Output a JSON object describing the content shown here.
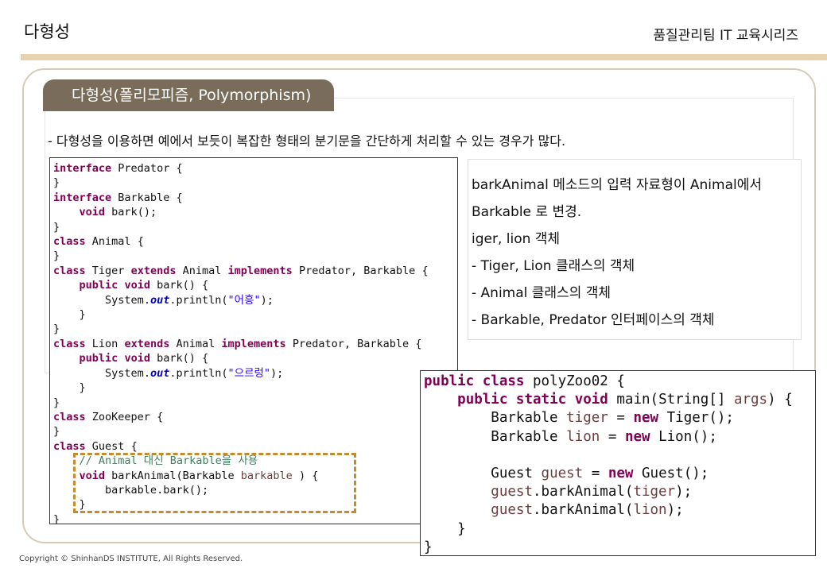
{
  "header": {
    "title": "다형성",
    "series": "품질관리팀 IT 교육시리즈"
  },
  "section": {
    "tab_label": "다형성(폴리모피즘, Polymorphism)",
    "intro": "- 다형성을 이용하면 예에서 보듯이 복잡한 형태의 분기문을 간단하게 처리할 수 있는 경우가 많다."
  },
  "notes": [
    "barkAnimal 메소드의 입력 자료형이 Animal에서",
    "Barkable 로 변경.",
    "iger, lion 객체",
    "- Tiger, Lion 클래스의 객체",
    "-  Animal 클래스의 객체",
    "-  Barkable, Predator 인터페이스의 객체"
  ],
  "code_left": [
    "interface Predator {",
    "}",
    "interface Barkable {",
    "    void bark();",
    "}",
    "class Animal {",
    "}",
    "class Tiger extends Animal implements Predator, Barkable {",
    "    public void bark() {",
    "        System.out.println(\"어흥\");",
    "    }",
    "}",
    "class Lion extends Animal implements Predator, Barkable {",
    "    public void bark() {",
    "        System.out.println(\"으르렁\");",
    "    }",
    "}",
    "class ZooKeeper {",
    "}",
    "class Guest {",
    "    // Animal 대신 Barkable을 사용",
    "    void barkAnimal(Barkable barkable ) {",
    "        barkable.bark();",
    "    }",
    "}"
  ],
  "code_right": [
    "public class polyZoo02 {",
    "    public static void main(String[] args) {",
    "        Barkable tiger = new Tiger();",
    "        Barkable lion = new Lion();",
    "",
    "        Guest guest = new Guest();",
    "        guest.barkAnimal(tiger);",
    "        guest.barkAnimal(lion);",
    "    }",
    "}"
  ],
  "footer": "Copyright © ShinhanDS INSTITUTE, All Rights Reserved.",
  "colors": {
    "keyword": "#7f0055",
    "comment": "#3f7f5f",
    "string": "#2a00ff",
    "static_field": "#0000c0",
    "variable": "#6a3e3e",
    "tab_bg": "#7a6c5a",
    "dash_highlight": "#c48b2c",
    "header_band": "#e8d3b0"
  }
}
